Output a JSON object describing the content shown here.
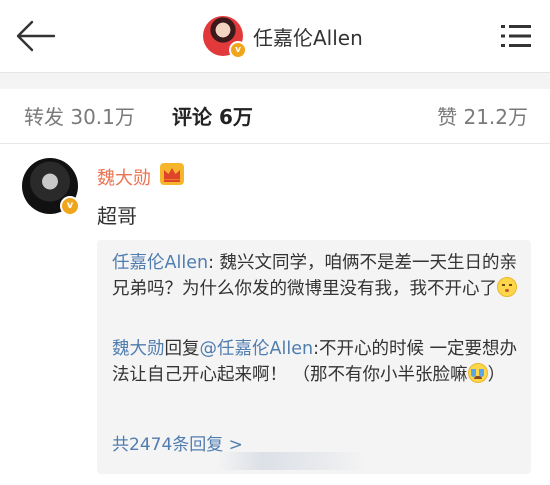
{
  "header": {
    "title": "任嘉伦Allen",
    "verified_mark": "v",
    "back_icon": "arrow-left-icon",
    "more_icon": "menu-lines-icon"
  },
  "tabs": {
    "repost": {
      "label": "转发",
      "count": "30.1万"
    },
    "comments": {
      "label": "评论",
      "count": "6万"
    },
    "likes": {
      "label": "赞",
      "count": "21.2万"
    }
  },
  "comment": {
    "author": "魏大勋",
    "verified_mark": "v",
    "badge_icon": "crown-icon",
    "text": "超哥",
    "replies": [
      {
        "author": "任嘉伦Allen",
        "separator": ": ",
        "text": "魏兴文同学，咱俩不是差一天生日的亲兄弟吗？为什么你发的微博里没有我，我不开心了",
        "emoji": "pouting-face-icon"
      },
      {
        "author": "魏大勋",
        "reply_word": "回复",
        "mention": "@任嘉伦Allen",
        "text": ":不开心的时候 一定要想办法让自己开心起来啊！ （那不有你小半张脸嘛",
        "emoji": "crying-face-icon",
        "text_end": "）"
      }
    ],
    "more_replies": "共2474条回复 >"
  },
  "colors": {
    "accent_name": "#eb7350",
    "link": "#507daf",
    "reply_bg": "#f4f4f4",
    "badge": "#f0a61c"
  }
}
